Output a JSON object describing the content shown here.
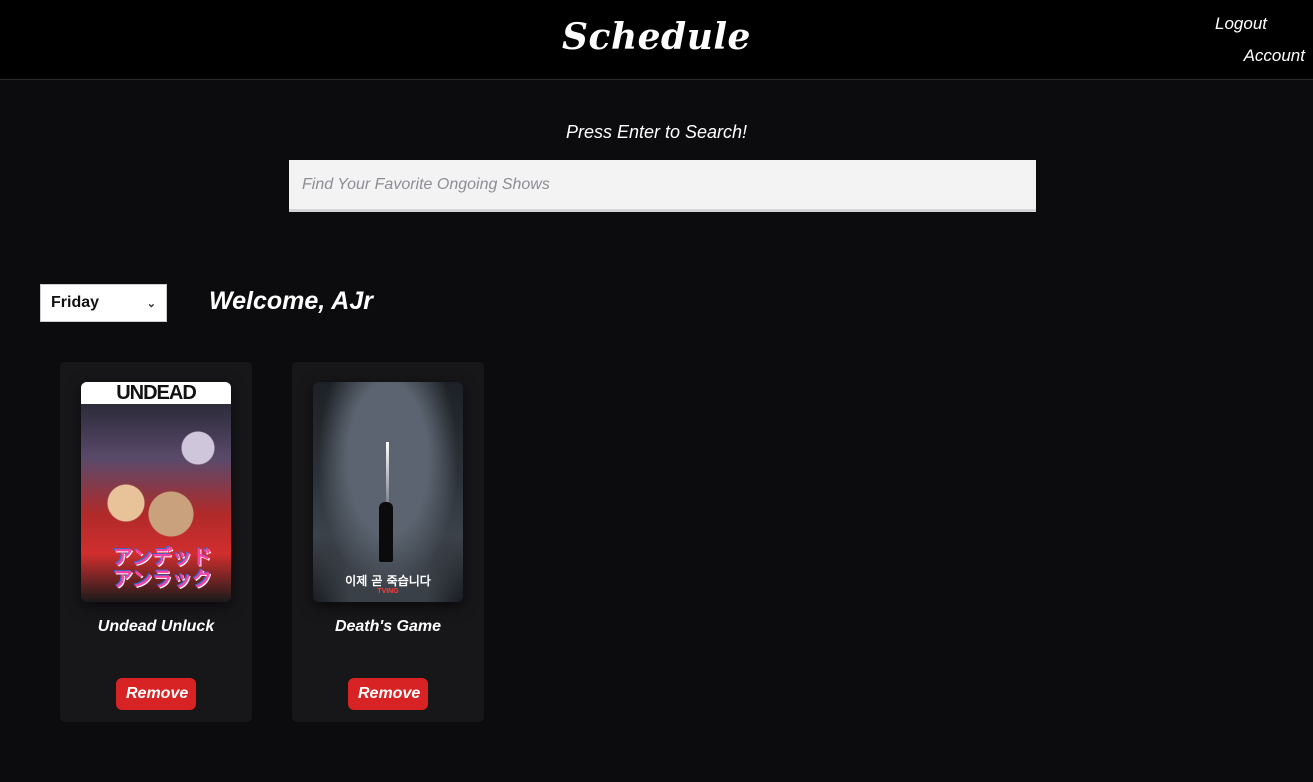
{
  "header": {
    "title": "Schedule",
    "logout_label": "Logout",
    "account_label": "Account"
  },
  "search": {
    "hint": "Press Enter to Search!",
    "placeholder": "Find Your Favorite Ongoing Shows",
    "value": ""
  },
  "schedule": {
    "selected_day": "Friday",
    "welcome": "Welcome, AJr"
  },
  "shows": [
    {
      "title": "Undead Unluck",
      "poster_text": "アンデッド\nアンラック",
      "remove_label": "Remove"
    },
    {
      "title": "Death's Game",
      "poster_text": "이제 곧 죽습니다",
      "remove_label": "Remove"
    }
  ],
  "colors": {
    "background": "#0c0c0e",
    "header": "#000000",
    "card": "#17171a",
    "remove_button": "#d72323"
  }
}
